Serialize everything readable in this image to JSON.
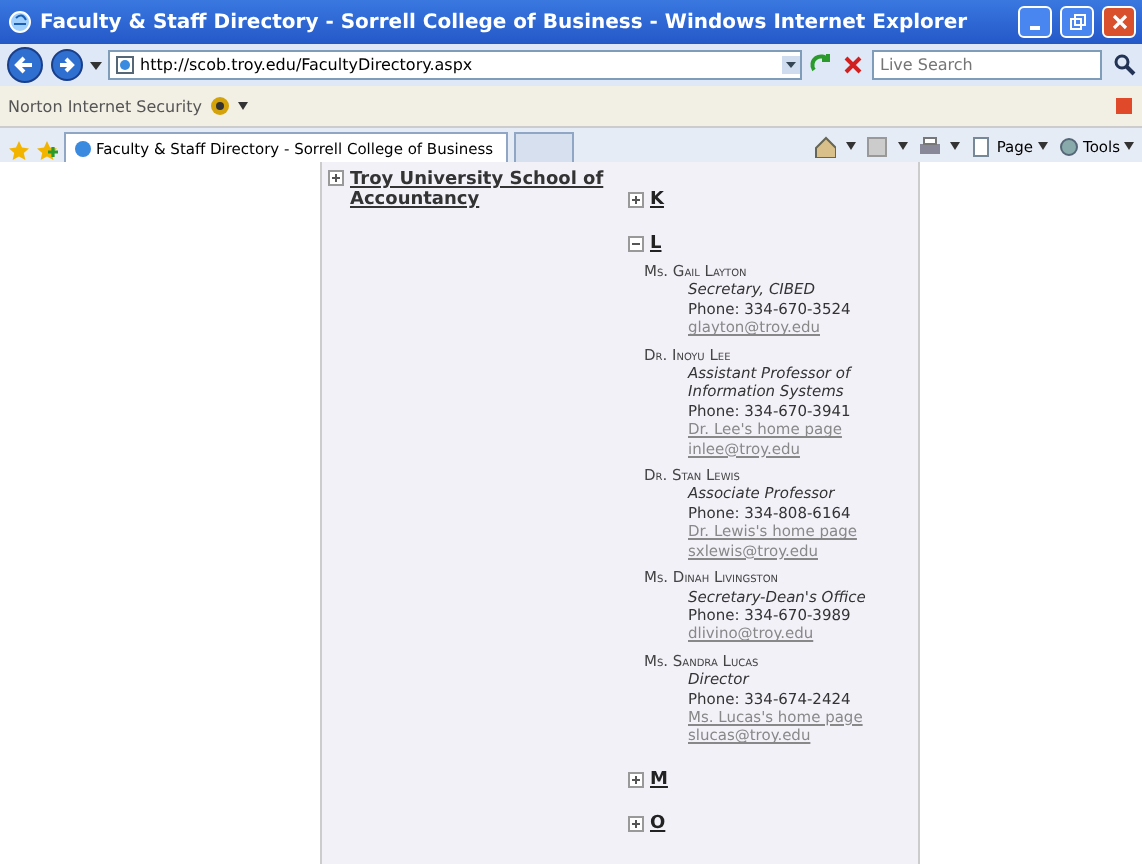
{
  "window": {
    "title": "Faculty & Staff Directory - Sorrell College of Business - Windows Internet Explorer"
  },
  "address_bar": {
    "url": "http://scob.troy.edu/FacultyDirectory.aspx",
    "search_placeholder": "Live Search"
  },
  "norton_bar": {
    "label": "Norton Internet Security"
  },
  "tabs": [
    {
      "label": "Faculty & Staff Directory - Sorrell College of Business",
      "selected": true
    },
    {
      "selected": false
    }
  ],
  "command_bar": {
    "buttons": [
      {
        "kind": "home"
      },
      {
        "kind": "feeds"
      },
      {
        "kind": "print"
      },
      {
        "kind": "page",
        "label": "Page"
      },
      {
        "kind": "tools",
        "label": "Tools"
      }
    ]
  },
  "departments": [
    {
      "label": "Troy University School of Accountancy",
      "expanded": false
    }
  ],
  "letter_groups": [
    {
      "letter": "K",
      "expanded": false
    },
    {
      "letter": "L",
      "expanded": true,
      "people": [
        {
          "name": "Ms. Gail Layton",
          "title": "Secretary, CIBED",
          "phone": "Phone: 334-670-3524",
          "email": "glayton@troy.edu"
        },
        {
          "name": "Dr. Inoyu Lee",
          "title": "Assistant Professor of Information Systems",
          "phone": "Phone: 334-670-3941",
          "homepage": "Dr. Lee's home page",
          "email": "inlee@troy.edu"
        },
        {
          "name": "Dr. Stan Lewis",
          "title": "Associate Professor",
          "phone": "Phone: 334-808-6164",
          "homepage": "Dr. Lewis's home page",
          "email": "sxlewis@troy.edu"
        },
        {
          "name": "Ms. Dinah Livingston",
          "title": "Secretary-Dean's Office",
          "phone": "Phone: 334-670-3989",
          "email": "dlivino@troy.edu"
        },
        {
          "name": "Ms. Sandra Lucas",
          "title": "Director",
          "phone": "Phone: 334-674-2424",
          "homepage": "Ms. Lucas's home page",
          "email": "slucas@troy.edu"
        }
      ]
    },
    {
      "letter": "M",
      "expanded": false
    },
    {
      "letter": "O",
      "expanded": false
    }
  ]
}
